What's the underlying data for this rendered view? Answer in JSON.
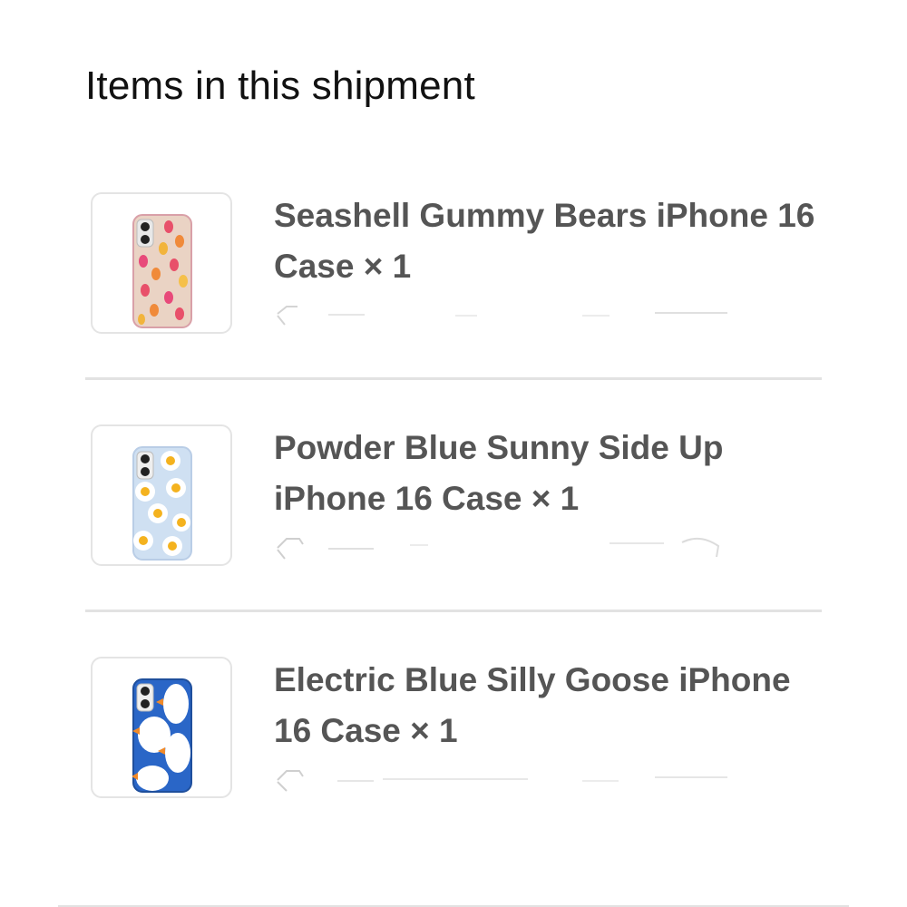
{
  "section": {
    "title": "Items in this shipment"
  },
  "items": [
    {
      "name": "Seashell Gummy Bears iPhone 16 Case × 1",
      "thumbnail": "seashell-gummy-bears-case-image",
      "case_color": "#ead3c4"
    },
    {
      "name": "Powder Blue Sunny Side Up iPhone 16 Case × 1",
      "thumbnail": "powder-blue-sunny-side-up-case-image",
      "case_color": "#cfe0f2"
    },
    {
      "name": "Electric Blue Silly Goose iPhone 16 Case × 1",
      "thumbnail": "electric-blue-silly-goose-case-image",
      "case_color": "#2a66c7"
    }
  ],
  "colors": {
    "title_text": "#111111",
    "item_text": "#555555",
    "divider": "#e2e2e2",
    "thumb_border": "#e4e4e4"
  }
}
